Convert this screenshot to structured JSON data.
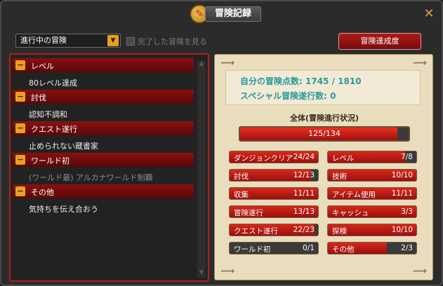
{
  "window": {
    "title": "冒険記録",
    "close_icon": "close-icon"
  },
  "filter": {
    "selected": "進行中の冒険",
    "show_completed_label": "完了した冒険を見る",
    "show_completed_checked": false
  },
  "achievement_button": "冒険達成度",
  "categories": [
    {
      "label": "レベル",
      "item": "80レベル達成",
      "item_dim": false
    },
    {
      "label": "討伐",
      "item": "認知不調和",
      "item_dim": false
    },
    {
      "label": "クエスト遂行",
      "item": "止められない蔵書家",
      "item_dim": false
    },
    {
      "label": "ワールド初",
      "item": "(ワールド最) アルカナワールド制覇",
      "item_dim": true
    },
    {
      "label": "その他",
      "item": "気持ちを伝え合おう",
      "item_dim": false
    }
  ],
  "stats": {
    "points_label": "自分の冒険点数:",
    "points_value": "1745",
    "points_sep": "/",
    "points_max": "1810",
    "special_label": "スペシャル冒険遂行数:",
    "special_value": "0"
  },
  "overall": {
    "title": "全体(冒険進行状況)",
    "text": "125/134",
    "fraction": 0.933
  },
  "progress": [
    {
      "name": "ダンジョンクリア",
      "text": "24/24",
      "fraction": 1.0
    },
    {
      "name": "レベル",
      "text": "7/8",
      "fraction": 0.875
    },
    {
      "name": "討伐",
      "text": "12/13",
      "fraction": 0.923
    },
    {
      "name": "技術",
      "text": "10/10",
      "fraction": 1.0
    },
    {
      "name": "収集",
      "text": "11/11",
      "fraction": 1.0
    },
    {
      "name": "アイテム使用",
      "text": "11/11",
      "fraction": 1.0
    },
    {
      "name": "冒険遂行",
      "text": "13/13",
      "fraction": 1.0
    },
    {
      "name": "キャッシュ",
      "text": "3/3",
      "fraction": 1.0
    },
    {
      "name": "クエスト遂行",
      "text": "22/23",
      "fraction": 0.957
    },
    {
      "name": "探検",
      "text": "10/10",
      "fraction": 1.0
    },
    {
      "name": "ワールド初",
      "text": "0/1",
      "fraction": 0.0
    },
    {
      "name": "その他",
      "text": "2/3",
      "fraction": 0.667
    }
  ]
}
